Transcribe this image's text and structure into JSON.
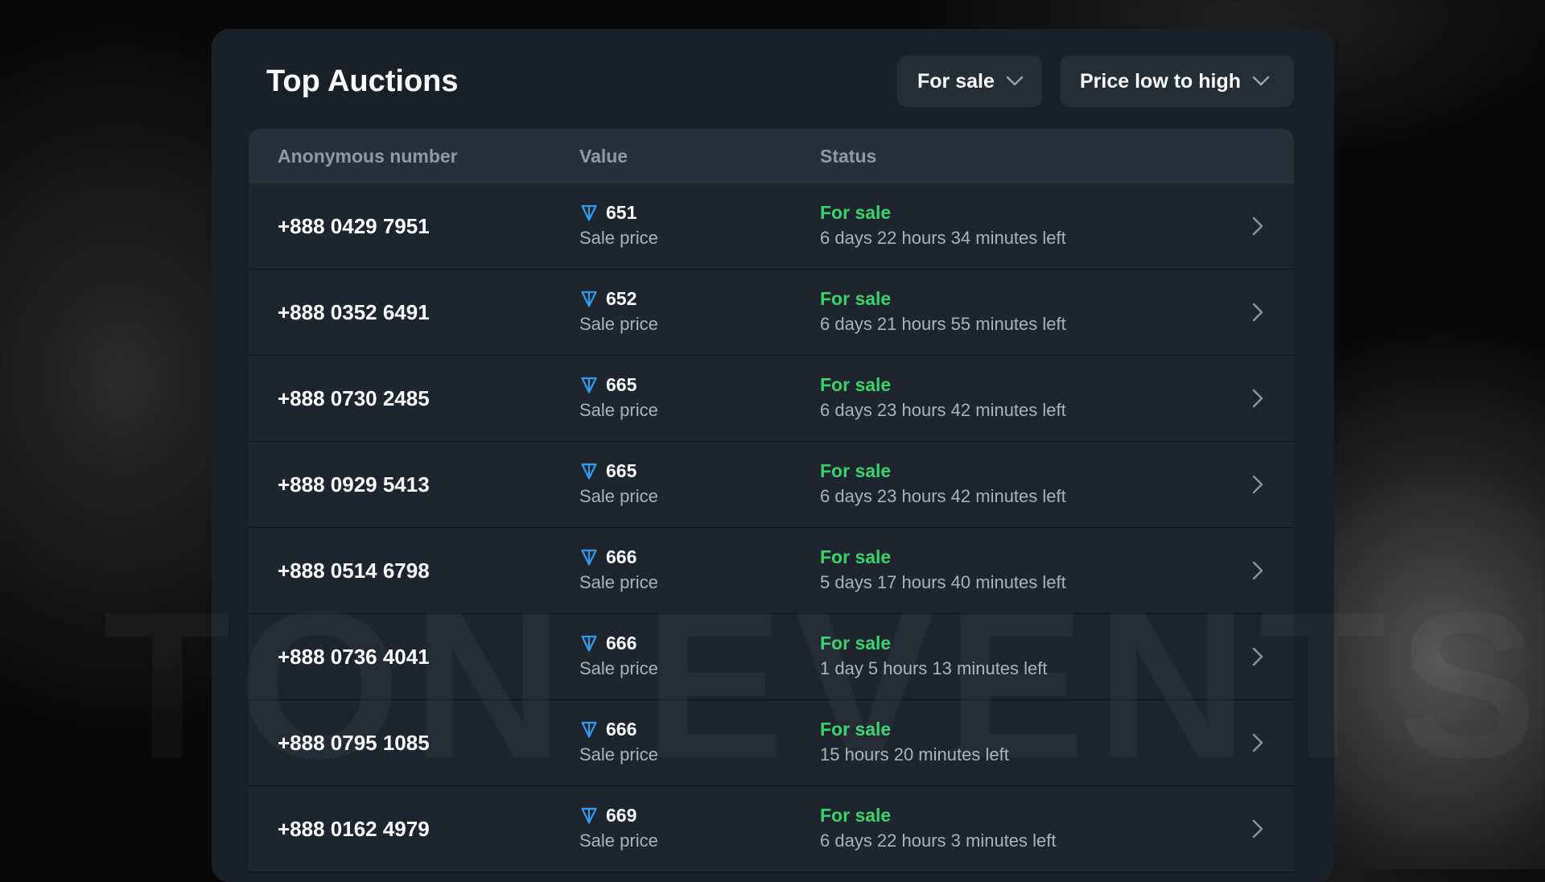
{
  "panel": {
    "title": "Top Auctions"
  },
  "filters": {
    "status": {
      "label": "For sale",
      "icon": "chevron-down-icon"
    },
    "sort": {
      "label": "Price low to high",
      "icon": "chevron-down-icon"
    }
  },
  "table": {
    "headers": {
      "number": "Anonymous number",
      "value": "Value",
      "status": "Status"
    },
    "rows": [
      {
        "number": "+888 0429 7951",
        "price": "651",
        "price_caption": "Sale price",
        "status": "For sale",
        "time_left": "6 days 22 hours 34 minutes left"
      },
      {
        "number": "+888 0352 6491",
        "price": "652",
        "price_caption": "Sale price",
        "status": "For sale",
        "time_left": "6 days 21 hours 55 minutes left"
      },
      {
        "number": "+888 0730 2485",
        "price": "665",
        "price_caption": "Sale price",
        "status": "For sale",
        "time_left": "6 days 23 hours 42 minutes left"
      },
      {
        "number": "+888 0929 5413",
        "price": "665",
        "price_caption": "Sale price",
        "status": "For sale",
        "time_left": "6 days 23 hours 42 minutes left"
      },
      {
        "number": "+888 0514 6798",
        "price": "666",
        "price_caption": "Sale price",
        "status": "For sale",
        "time_left": "5 days 17 hours 40 minutes left"
      },
      {
        "number": "+888 0736 4041",
        "price": "666",
        "price_caption": "Sale price",
        "status": "For sale",
        "time_left": "1 day 5 hours 13 minutes left"
      },
      {
        "number": "+888 0795 1085",
        "price": "666",
        "price_caption": "Sale price",
        "status": "For sale",
        "time_left": "15 hours 20 minutes left"
      },
      {
        "number": "+888 0162 4979",
        "price": "669",
        "price_caption": "Sale price",
        "status": "For sale",
        "time_left": "6 days 22 hours 3 minutes left"
      }
    ]
  },
  "watermark": "TON EVENTS",
  "colors": {
    "background": "#080808",
    "panel": "#1a2027",
    "header_row": "#26303b",
    "status_green": "#37d36b",
    "ton_blue": "#2f9bf1",
    "muted_text": "#a9b3bd"
  },
  "icons": {
    "currency": "ton-diamond-icon",
    "row_action": "chevron-right-icon"
  }
}
